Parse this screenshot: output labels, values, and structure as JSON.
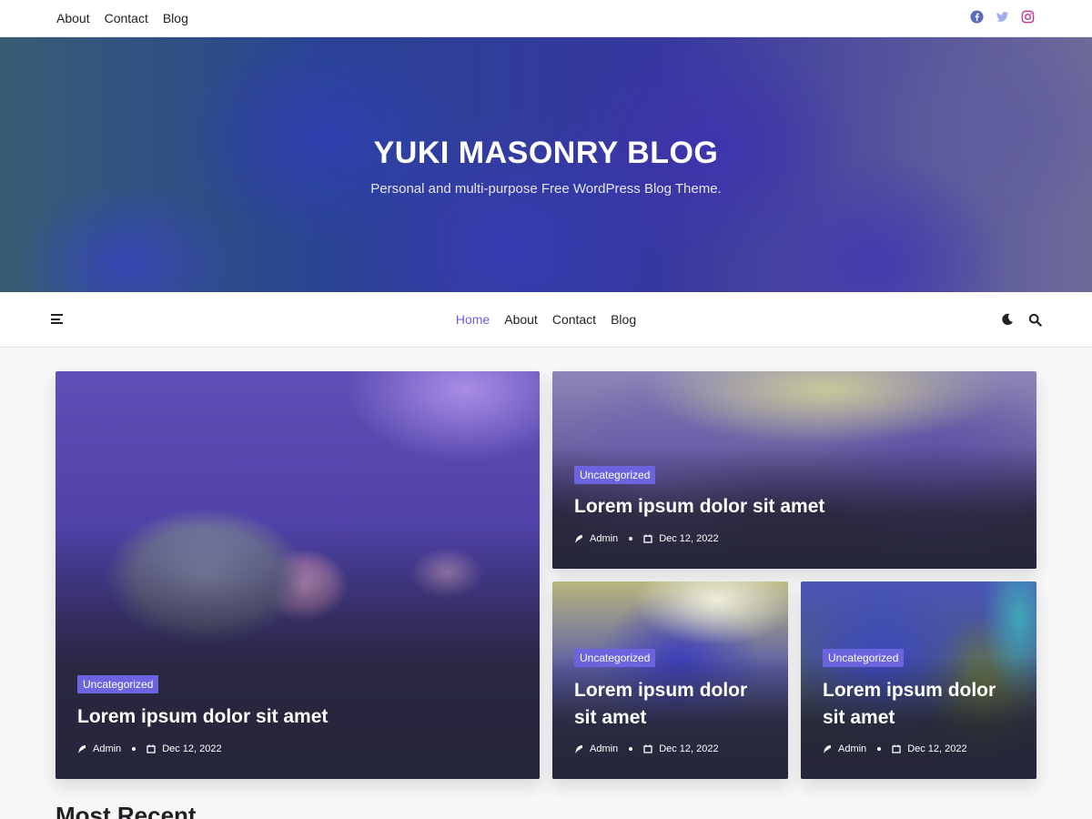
{
  "topbar": {
    "links": [
      "About",
      "Contact",
      "Blog"
    ],
    "social": [
      "facebook-icon",
      "twitter-icon",
      "instagram-icon"
    ]
  },
  "hero": {
    "title": "YUKI MASONRY BLOG",
    "subtitle": "Personal and multi-purpose Free WordPress Blog Theme."
  },
  "nav": {
    "items": [
      "Home",
      "About",
      "Contact",
      "Blog"
    ],
    "active": "Home"
  },
  "posts": [
    {
      "category": "Uncategorized",
      "title": "Lorem ipsum dolor sit amet",
      "author": "Admin",
      "date": "Dec 12, 2022"
    },
    {
      "category": "Uncategorized",
      "title": "Lorem ipsum dolor sit amet",
      "author": "Admin",
      "date": "Dec 12, 2022"
    },
    {
      "category": "Uncategorized",
      "title": "Lorem ipsum dolor sit amet",
      "author": "Admin",
      "date": "Dec 12, 2022"
    },
    {
      "category": "Uncategorized",
      "title": "Lorem ipsum dolor sit amet",
      "author": "Admin",
      "date": "Dec 12, 2022"
    }
  ],
  "section": {
    "most_recent": "Most Recent"
  },
  "colors": {
    "accent": "#6c63de",
    "facebook": "#5b6bb8",
    "twitter": "#9fb0f0",
    "instagram": "#c2418f"
  }
}
